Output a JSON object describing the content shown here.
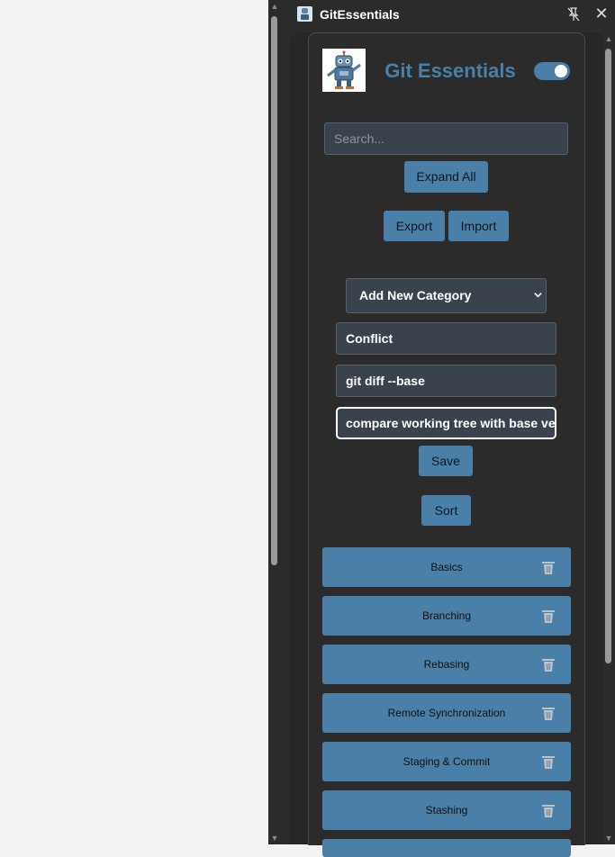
{
  "window": {
    "title": "GitEssentials"
  },
  "header": {
    "brand": "Git Essentials"
  },
  "search": {
    "placeholder": "Search..."
  },
  "buttons": {
    "expand_all": "Expand All",
    "export": "Export",
    "import": "Import",
    "save": "Save",
    "sort": "Sort"
  },
  "category_select": {
    "selected": "Add New Category"
  },
  "form": {
    "category": "Conflict",
    "command": "git diff --base",
    "description": "compare working tree with base version"
  },
  "categories": [
    {
      "label": "Basics"
    },
    {
      "label": "Branching"
    },
    {
      "label": "Rebasing"
    },
    {
      "label": "Remote Synchronization"
    },
    {
      "label": "Staging & Commit"
    },
    {
      "label": "Stashing"
    }
  ],
  "icons": {
    "app": "robot-icon",
    "unpin": "unpin-icon",
    "close": "close-icon",
    "trash": "trash-icon",
    "dropdown": "chevron-down-icon"
  },
  "colors": {
    "accent": "#4a7fa8",
    "background": "#2b2b2b",
    "input_bg": "#3a434d",
    "outside": "#f3f3f3"
  }
}
